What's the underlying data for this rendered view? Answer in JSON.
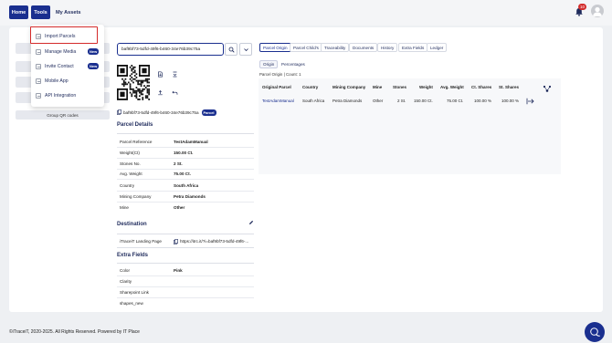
{
  "topnav": {
    "home_label": "Home",
    "tools_label": "Tools",
    "assets_label": "My Assets",
    "notification_count": "10"
  },
  "tools_menu": {
    "items": [
      {
        "label": "Import Parcels",
        "badge": ""
      },
      {
        "label": "Manage Media",
        "badge": "New"
      },
      {
        "label": "Invite Contact",
        "badge": "New"
      },
      {
        "label": "Mobile App",
        "badge": ""
      },
      {
        "label": "API Integration",
        "badge": ""
      }
    ]
  },
  "sidebar": {
    "group_qr_label": "Group QR codes"
  },
  "search": {
    "value": "baf9bf73-5dfd-49f6-b460-34e76b39c75a"
  },
  "asset": {
    "id": "baf9bf73-5dfd-49f6-b460-34e76b39c75a",
    "type_badge": "Parcel"
  },
  "parcel_details": {
    "title": "Parcel Details",
    "rows": [
      {
        "label": "Parcel Reference",
        "value": "TestAdamManual"
      },
      {
        "label": "Weight(Ct)",
        "value": "150.00 Ct."
      },
      {
        "label": "Stones No.",
        "value": "2 St."
      },
      {
        "label": "Avg. Weight",
        "value": "75.00 Ct."
      },
      {
        "label": "Country",
        "value": "South Africa"
      },
      {
        "label": "Mining Company",
        "value": "Petra Diamonds"
      },
      {
        "label": "Mine",
        "value": "Other"
      }
    ]
  },
  "destination": {
    "title": "Destination",
    "label": "iTraceiT Landing Page",
    "value": "https://itrc.it/?i=baf9bf73-5dfd-49f6-..."
  },
  "extra_fields": {
    "title": "Extra Fields",
    "rows": [
      {
        "label": "Color",
        "value": "Pink"
      },
      {
        "label": "Clarity",
        "value": ""
      },
      {
        "label": "Sharepoint Link",
        "value": ""
      },
      {
        "label": "shapes_new",
        "value": ""
      }
    ]
  },
  "tabs": [
    "Parcel Origin",
    "Parcel Child's",
    "Traceability",
    "Documents",
    "History",
    "Extra Fields",
    "Ledger"
  ],
  "subtabs": [
    "Origin",
    "Percentages"
  ],
  "origin_count": "Parcel Origin | Count: 1",
  "origin_table": {
    "headers": [
      "Original Parcel",
      "Country",
      "Mining Company",
      "Mine",
      "Stones",
      "Weight",
      "Avg. Weight",
      "Ct. Shares",
      "St. Shares"
    ],
    "row": [
      "TestAdamManual",
      "South Africa",
      "Petra Diamonds",
      "Other",
      "2 St.",
      "150.00 Ct.",
      "75.00 Ct.",
      "100.00 %",
      "100.00 %"
    ]
  },
  "footer": {
    "text": "©iTraceiT, 2020-2025. All Rights Reserved. Powered by IT Place"
  },
  "colors": {
    "primary": "#1a2f8f",
    "highlight_red": "#d42a2a",
    "notification_red": "#d32d2d"
  }
}
